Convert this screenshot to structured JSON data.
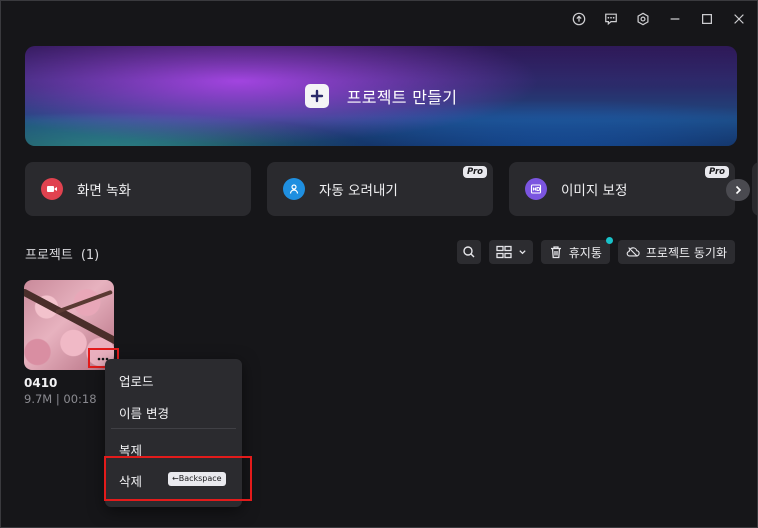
{
  "window": {
    "icons": [
      "upload-icon",
      "feedback-icon",
      "settings-icon",
      "minimize-icon",
      "maximize-icon",
      "close-icon"
    ]
  },
  "hero": {
    "label": "프로젝트 만들기"
  },
  "tools": [
    {
      "label": "화면 녹화",
      "icon": "record-icon",
      "color": "#e0424f",
      "pro": ""
    },
    {
      "label": "자동 오려내기",
      "icon": "cutout-icon",
      "color": "#1f8fe0",
      "pro": "Pro"
    },
    {
      "label": "이미지 보정",
      "icon": "enhance-icon",
      "color": "#7b55e0",
      "pro": "Pro"
    }
  ],
  "projects_header": {
    "title": "프로젝트",
    "count": "(1)",
    "trash_label": "휴지통",
    "sync_label": "프로젝트 동기화"
  },
  "project": {
    "name": "0410",
    "size": "9.7M",
    "separator": "|",
    "duration": "00:18"
  },
  "context_menu": {
    "upload": "업로드",
    "rename": "이름 변경",
    "duplicate": "복제",
    "delete": "삭제",
    "delete_shortcut": "←Backspace"
  },
  "highlight_color": "#e31b1b",
  "accent_dot_color": "#19c2c9"
}
